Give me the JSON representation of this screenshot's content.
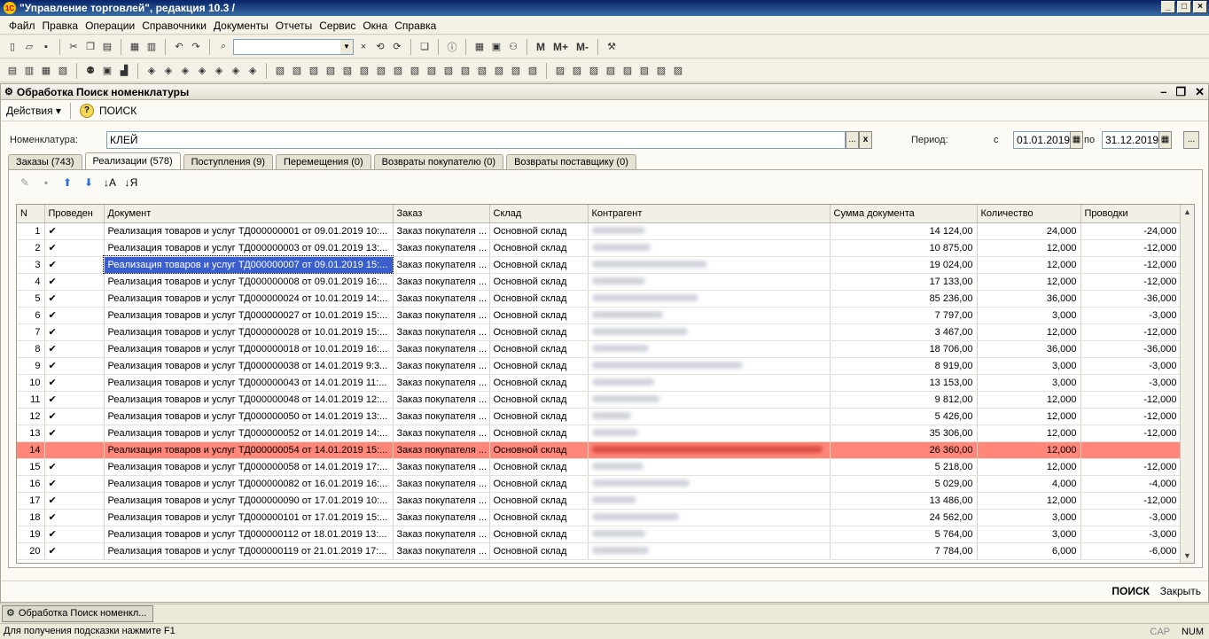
{
  "app": {
    "title": "\"Управление торговлей\", редакция 10.3 /",
    "logo": "1C"
  },
  "menu": [
    "Файл",
    "Правка",
    "Операции",
    "Справочники",
    "Документы",
    "Отчеты",
    "Сервис",
    "Окна",
    "Справка"
  ],
  "toolbar": {
    "m_label": "M",
    "mplus_label": "M+",
    "mminus_label": "M-"
  },
  "window": {
    "title": "Обработка  Поиск номенклатуры"
  },
  "actions": {
    "menu_label": "Действия",
    "search_label": "ПОИСК"
  },
  "form": {
    "nomenclature_label": "Номенклатура:",
    "nomenclature_value": "КЛЕЙ",
    "period_label": "Период:",
    "from_label": "с",
    "from_value": "01.01.2019",
    "to_label": "по",
    "to_value": "31.12.2019",
    "ellipsis": "...",
    "clear": "x"
  },
  "tabs": [
    "Заказы (743)",
    "Реализации (578)",
    "Поступления (9)",
    "Перемещения (0)",
    "Возвраты покупателю (0)",
    "Возвраты поставщику (0)"
  ],
  "table": {
    "headers": [
      "N",
      "Проведен",
      "Документ",
      "Заказ",
      "Склад",
      "Контрагент",
      "Сумма документа",
      "Количество",
      "Проводки"
    ],
    "rows": [
      {
        "n": "1",
        "posted": "✔",
        "doc": "Реализация товаров и услуг ТД000000001 от 09.01.2019 10:...",
        "order": "Заказ покупателя ...",
        "warehouse": "Основной склад",
        "sum": "14 124,00",
        "qty": "24,000",
        "entries": "-24,000"
      },
      {
        "n": "2",
        "posted": "✔",
        "doc": "Реализация товаров и услуг ТД000000003 от 09.01.2019 13:...",
        "order": "Заказ покупателя ...",
        "warehouse": "Основной склад",
        "sum": "10 875,00",
        "qty": "12,000",
        "entries": "-12,000"
      },
      {
        "n": "3",
        "posted": "✔",
        "doc": "Реализация товаров и услуг ТД000000007 от 09.01.2019 15:...",
        "order": "Заказ покупателя ...",
        "warehouse": "Основной склад",
        "sum": "19 024,00",
        "qty": "12,000",
        "entries": "-12,000"
      },
      {
        "n": "4",
        "posted": "✔",
        "doc": "Реализация товаров и услуг ТД000000008 от 09.01.2019 16:...",
        "order": "Заказ покупателя ...",
        "warehouse": "Основной склад",
        "sum": "17 133,00",
        "qty": "12,000",
        "entries": "-12,000"
      },
      {
        "n": "5",
        "posted": "✔",
        "doc": "Реализация товаров и услуг ТД000000024 от 10.01.2019 14:...",
        "order": "Заказ покупателя ...",
        "warehouse": "Основной склад",
        "sum": "85 236,00",
        "qty": "36,000",
        "entries": "-36,000"
      },
      {
        "n": "6",
        "posted": "✔",
        "doc": "Реализация товаров и услуг ТД000000027 от 10.01.2019 15:...",
        "order": "Заказ покупателя ...",
        "warehouse": "Основной склад",
        "sum": "7 797,00",
        "qty": "3,000",
        "entries": "-3,000"
      },
      {
        "n": "7",
        "posted": "✔",
        "doc": "Реализация товаров и услуг ТД000000028 от 10.01.2019 15:...",
        "order": "Заказ покупателя ...",
        "warehouse": "Основной склад",
        "sum": "3 467,00",
        "qty": "12,000",
        "entries": "-12,000"
      },
      {
        "n": "8",
        "posted": "✔",
        "doc": "Реализация товаров и услуг ТД000000018 от 10.01.2019 16:...",
        "order": "Заказ покупателя ...",
        "warehouse": "Основной склад",
        "sum": "18 706,00",
        "qty": "36,000",
        "entries": "-36,000"
      },
      {
        "n": "9",
        "posted": "✔",
        "doc": "Реализация товаров и услуг ТД000000038 от 14.01.2019 9:3...",
        "order": "Заказ покупателя ...",
        "warehouse": "Основной склад",
        "sum": "8 919,00",
        "qty": "3,000",
        "entries": "-3,000"
      },
      {
        "n": "10",
        "posted": "✔",
        "doc": "Реализация товаров и услуг ТД000000043 от 14.01.2019 11:...",
        "order": "Заказ покупателя ...",
        "warehouse": "Основной склад",
        "sum": "13 153,00",
        "qty": "3,000",
        "entries": "-3,000"
      },
      {
        "n": "11",
        "posted": "✔",
        "doc": "Реализация товаров и услуг ТД000000048 от 14.01.2019 12:...",
        "order": "Заказ покупателя ...",
        "warehouse": "Основной склад",
        "sum": "9 812,00",
        "qty": "12,000",
        "entries": "-12,000"
      },
      {
        "n": "12",
        "posted": "✔",
        "doc": "Реализация товаров и услуг ТД000000050 от 14.01.2019 13:...",
        "order": "Заказ покупателя ...",
        "warehouse": "Основной склад",
        "sum": "5 426,00",
        "qty": "12,000",
        "entries": "-12,000"
      },
      {
        "n": "13",
        "posted": "✔",
        "doc": "Реализация товаров и услуг ТД000000052 от 14.01.2019 14:...",
        "order": "Заказ покупателя ...",
        "warehouse": "Основной склад",
        "sum": "35 306,00",
        "qty": "12,000",
        "entries": "-12,000"
      },
      {
        "n": "14",
        "posted": "",
        "doc": "Реализация товаров и услуг ТД000000054 от 14.01.2019 15:...",
        "order": "Заказ покупателя ...",
        "warehouse": "Основной склад",
        "sum": "26 360,00",
        "qty": "12,000",
        "entries": ""
      },
      {
        "n": "15",
        "posted": "✔",
        "doc": "Реализация товаров и услуг ТД000000058 от 14.01.2019 17:...",
        "order": "Заказ покупателя ...",
        "warehouse": "Основной склад",
        "sum": "5 218,00",
        "qty": "12,000",
        "entries": "-12,000"
      },
      {
        "n": "16",
        "posted": "✔",
        "doc": "Реализация товаров и услуг ТД000000082 от 16.01.2019 16:...",
        "order": "Заказ покупателя ...",
        "warehouse": "Основной склад",
        "sum": "5 029,00",
        "qty": "4,000",
        "entries": "-4,000"
      },
      {
        "n": "17",
        "posted": "✔",
        "doc": "Реализация товаров и услуг ТД000000090 от 17.01.2019 10:...",
        "order": "Заказ покупателя ...",
        "warehouse": "Основной склад",
        "sum": "13 486,00",
        "qty": "12,000",
        "entries": "-12,000"
      },
      {
        "n": "18",
        "posted": "✔",
        "doc": "Реализация товаров и услуг ТД000000101 от 17.01.2019 15:...",
        "order": "Заказ покупателя ...",
        "warehouse": "Основной склад",
        "sum": "24 562,00",
        "qty": "3,000",
        "entries": "-3,000"
      },
      {
        "n": "19",
        "posted": "✔",
        "doc": "Реализация товаров и услуг ТД000000112 от 18.01.2019 13:...",
        "order": "Заказ покупателя ...",
        "warehouse": "Основной склад",
        "sum": "5 764,00",
        "qty": "3,000",
        "entries": "-3,000"
      },
      {
        "n": "20",
        "posted": "✔",
        "doc": "Реализация товаров и услуг ТД000000119 от 21.01.2019 17:...",
        "order": "Заказ покупателя ...",
        "warehouse": "Основной склад",
        "sum": "7 784,00",
        "qty": "6,000",
        "entries": "-6,000"
      }
    ]
  },
  "bottom": {
    "search_label": "ПОИСК",
    "close_label": "Закрыть"
  },
  "taskbar": {
    "item_label": "Обработка  Поиск номенкл..."
  },
  "status": {
    "hint": "Для получения подсказки нажмите F1",
    "cap": "CAP",
    "num": "NUM"
  },
  "colors": {
    "highlight_row": "#ff8678",
    "selection": "#3a5fcd"
  }
}
